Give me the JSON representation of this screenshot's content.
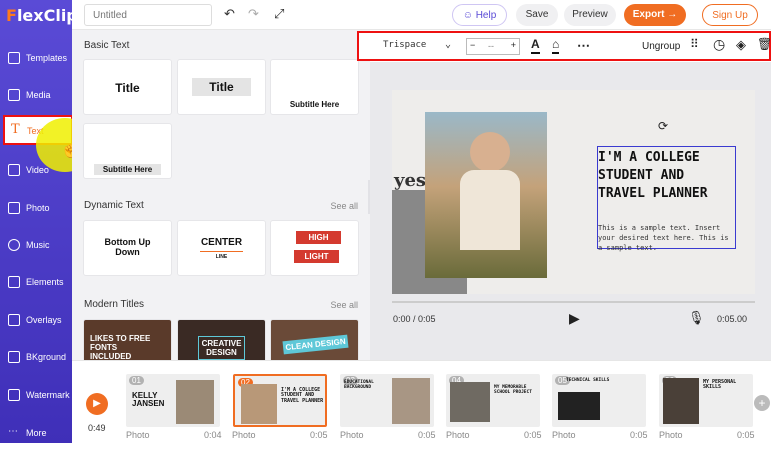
{
  "brand": {
    "part1": "F",
    "part2": "lexClip"
  },
  "sidebar": {
    "items": [
      {
        "label": "Templates"
      },
      {
        "label": "Media"
      },
      {
        "label": "Text"
      },
      {
        "label": "Video"
      },
      {
        "label": "Photo"
      },
      {
        "label": "Music"
      },
      {
        "label": "Elements"
      },
      {
        "label": "Overlays"
      },
      {
        "label": "BKground"
      },
      {
        "label": "Watermark"
      },
      {
        "label": "More"
      }
    ]
  },
  "topbar": {
    "title_placeholder": "Untitled",
    "help": "Help",
    "save": "Save",
    "preview": "Preview",
    "export": "Export",
    "signup": "Sign Up"
  },
  "toolbar": {
    "font": "Trispace",
    "size": "--",
    "ungroup": "Ungroup"
  },
  "panel": {
    "basic_text": "Basic Text",
    "basic": {
      "title1": "Title",
      "title2": "Title",
      "subtitle1": "Subtitle Here",
      "subtitle2": "Subtitle Here"
    },
    "dynamic_text": "Dynamic Text",
    "see_all": "See all",
    "dynamic": {
      "bottom_up": "Bottom Up Down",
      "center": "CENTER",
      "line": "LINE",
      "high": "HIGH",
      "light": "LIGHT"
    },
    "modern_titles": "Modern Titles",
    "modern": {
      "card1": "LIKES TO FREE FONTS INCLUDED",
      "card2": "CREATIVE DESIGN",
      "card3": "CLEAN DESIGN"
    }
  },
  "slide": {
    "heading": "I'M A COLLEGE STUDENT AND TRAVEL PLANNER",
    "body": "This is a sample text. Insert your desired text here. This is a sample text.",
    "yes": "yes."
  },
  "player": {
    "current": "0:00 / 0:05",
    "total": "0:05.00"
  },
  "timeline": {
    "total": "0:49",
    "clips": [
      {
        "num": "01",
        "text": "KELLY JANSEN",
        "type": "Photo",
        "dur": "0:04"
      },
      {
        "num": "02",
        "text": "I'M A COLLEGE STUDENT AND TRAVEL PLANNER",
        "type": "Photo",
        "dur": "0:05"
      },
      {
        "num": "03",
        "text": "EDUCATIONAL BACKGROUND",
        "type": "Photo",
        "dur": "0:05"
      },
      {
        "num": "04",
        "text": "MY MEMORABLE SCHOOL PROJECT",
        "type": "Photo",
        "dur": "0:05"
      },
      {
        "num": "05",
        "text": "TECHNICAL SKILLS",
        "type": "Photo",
        "dur": "0:05"
      },
      {
        "num": "06",
        "text": "MY PERSONAL SKILLS",
        "type": "Photo",
        "dur": "0:05"
      }
    ]
  },
  "colors": {
    "accent": "#f06d22",
    "sidebar": "#4a3fd1",
    "highlight_border": "#e11111"
  }
}
